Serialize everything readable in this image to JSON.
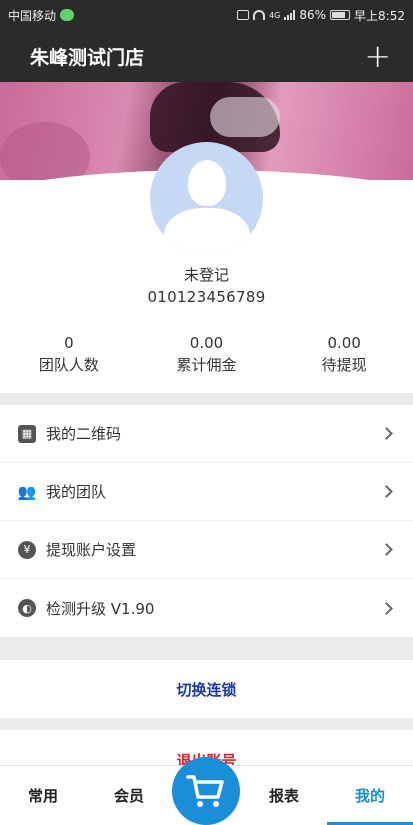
{
  "status_bar": {
    "carrier": "中国移动",
    "network": "4G",
    "battery": "86%",
    "time": "早上8:52"
  },
  "header": {
    "title": "朱峰测试门店",
    "add_icon": "plus-icon"
  },
  "profile": {
    "name": "未登记",
    "phone": "010123456789",
    "stats": [
      {
        "value": "0",
        "label": "团队人数"
      },
      {
        "value": "0.00",
        "label": "累计佣金"
      },
      {
        "value": "0.00",
        "label": "待提现"
      }
    ]
  },
  "menu": {
    "items": [
      {
        "label": "我的二维码",
        "icon": "qrcode-icon"
      },
      {
        "label": "我的团队",
        "icon": "team-icon"
      },
      {
        "label": "提现账户设置",
        "icon": "money-bag-icon"
      },
      {
        "label": "检测升级 V1.90",
        "icon": "globe-icon"
      }
    ]
  },
  "actions": {
    "switch_chain": "切换连锁",
    "logout": "退出账号"
  },
  "bottom_nav": {
    "tabs": [
      "常用",
      "会员",
      "报表",
      "我的"
    ],
    "active": "我的",
    "center_icon": "cart-icon"
  },
  "colors": {
    "header_bg": "#2b2b2b",
    "accent": "#1a8fd8",
    "switch_text": "#1c37a8",
    "logout_text": "#d8252b"
  }
}
